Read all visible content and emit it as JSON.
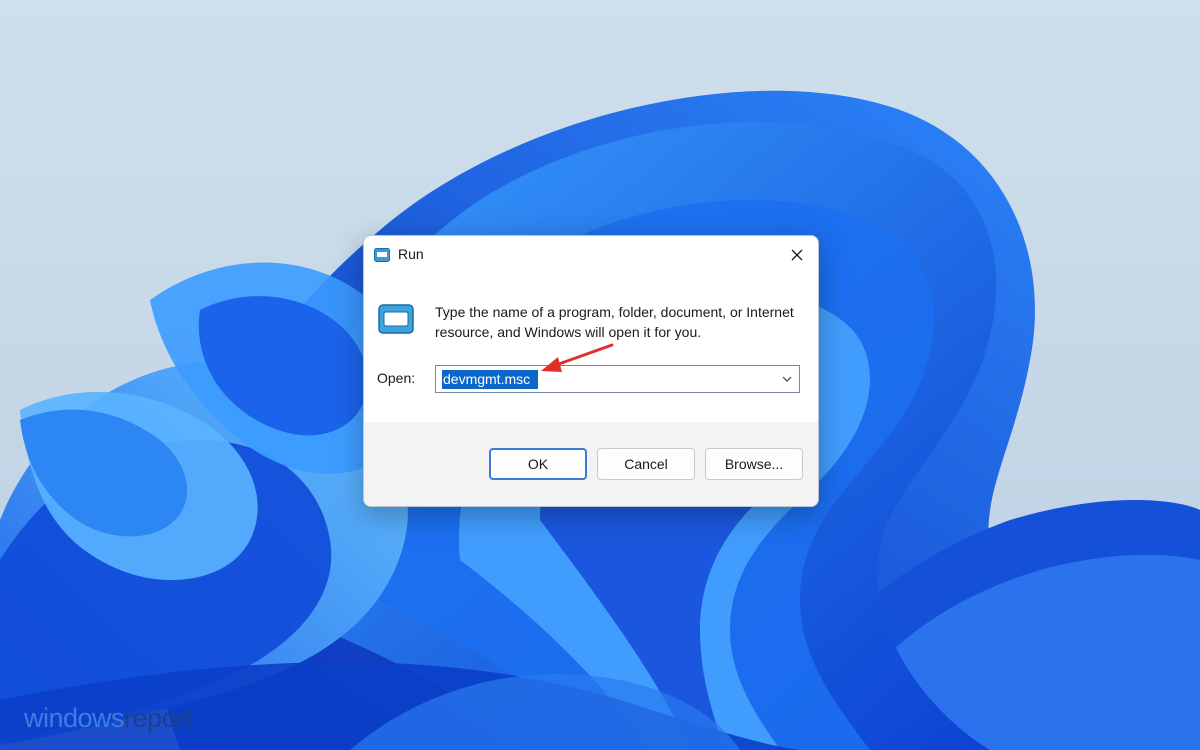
{
  "dialog": {
    "title": "Run",
    "description": "Type the name of a program, folder, document, or Internet resource, and Windows will open it for you.",
    "open_label": "Open:",
    "open_value": "devmgmt.msc",
    "buttons": {
      "ok": "OK",
      "cancel": "Cancel",
      "browse": "Browse..."
    }
  },
  "icons": {
    "title_icon": "run-icon",
    "big_icon": "run-icon",
    "close": "close-icon",
    "dropdown": "chevron-down-icon"
  },
  "watermark": {
    "part1": "windows",
    "part2": "report"
  },
  "colors": {
    "selection": "#0b67c9",
    "annotation_arrow": "#e0302a",
    "ok_border": "#3a7bd5"
  }
}
